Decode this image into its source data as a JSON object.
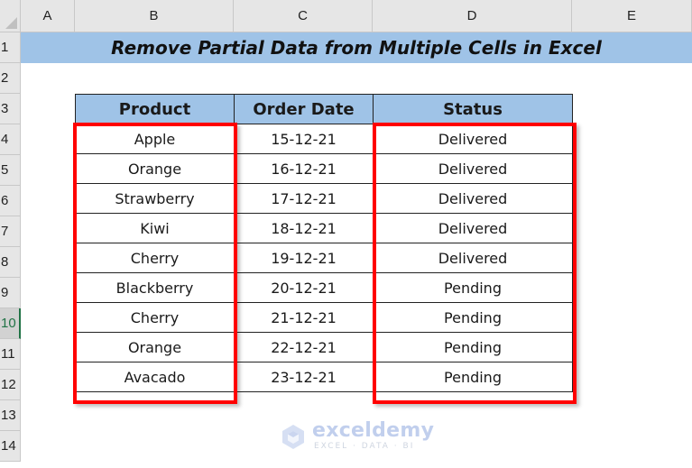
{
  "sheet": {
    "column_headers": [
      "A",
      "B",
      "C",
      "D",
      "E"
    ],
    "row_headers": [
      "1",
      "2",
      "3",
      "4",
      "5",
      "6",
      "7",
      "8",
      "9",
      "10",
      "11",
      "12",
      "13",
      "14"
    ],
    "selected_row": "10",
    "title": "Remove Partial Data from Multiple Cells in Excel",
    "table": {
      "headers": [
        "Product",
        "Order Date",
        "Status"
      ],
      "rows": [
        [
          "Apple",
          "15-12-21",
          "Delivered"
        ],
        [
          "Orange",
          "16-12-21",
          "Delivered"
        ],
        [
          "Strawberry",
          "17-12-21",
          "Delivered"
        ],
        [
          "Kiwi",
          "18-12-21",
          "Delivered"
        ],
        [
          "Cherry",
          "19-12-21",
          "Delivered"
        ],
        [
          "Blackberry",
          "20-12-21",
          "Pending"
        ],
        [
          "Cherry",
          "21-12-21",
          "Pending"
        ],
        [
          "Orange",
          "22-12-21",
          "Pending"
        ],
        [
          "Avacado",
          "23-12-21",
          "Pending"
        ]
      ]
    },
    "highlighted_columns": [
      "Product",
      "Status"
    ],
    "colors": {
      "title_fill": "#9fc3e7",
      "header_fill": "#9fc3e7",
      "highlight_border": "#ff0000",
      "selected_row_accent": "#217346"
    }
  },
  "watermark": {
    "brand": "exceldemy",
    "tagline": "EXCEL · DATA · BI"
  }
}
